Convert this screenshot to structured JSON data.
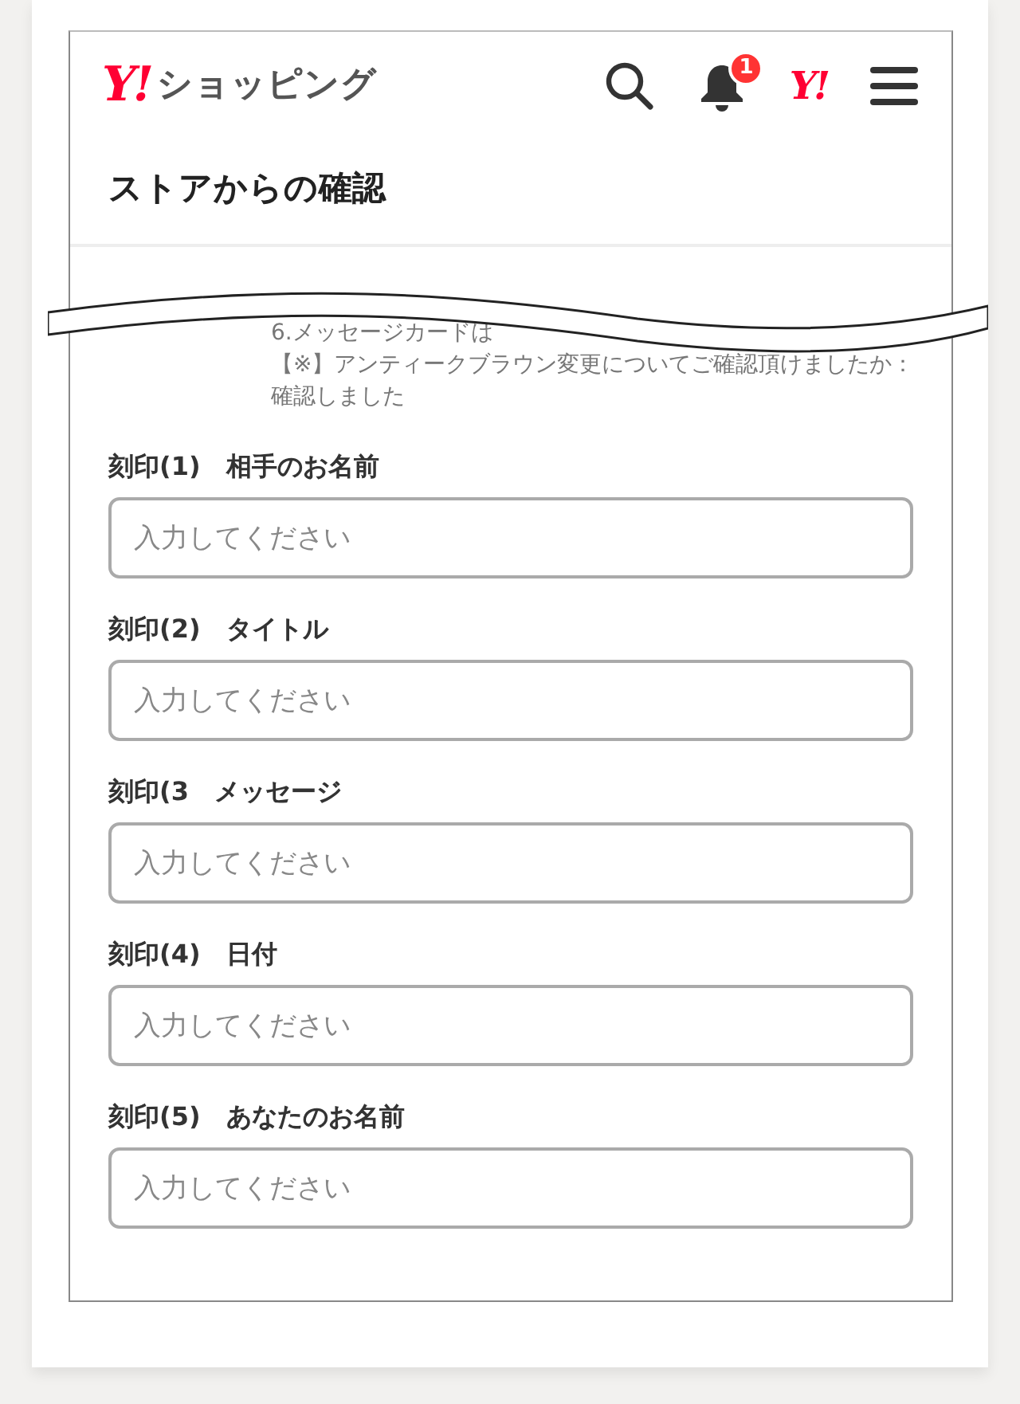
{
  "header": {
    "logo_mark": "Y!",
    "logo_text": "ショッピング",
    "notification_count": "1",
    "account_mark": "Y!"
  },
  "title": "ストアからの確認",
  "notes": [
    "6.メッセージカードは",
    "【※】アンティークブラウン変更についてご確認頂けましたか：確認しました"
  ],
  "fields": [
    {
      "label": "刻印(1)　相手のお名前",
      "placeholder": "入力してください"
    },
    {
      "label": "刻印(2)　タイトル",
      "placeholder": "入力してください"
    },
    {
      "label": "刻印(3　メッセージ",
      "placeholder": "入力してください"
    },
    {
      "label": "刻印(4)　日付",
      "placeholder": "入力してください"
    },
    {
      "label": "刻印(5)　あなたのお名前",
      "placeholder": "入力してください"
    }
  ]
}
